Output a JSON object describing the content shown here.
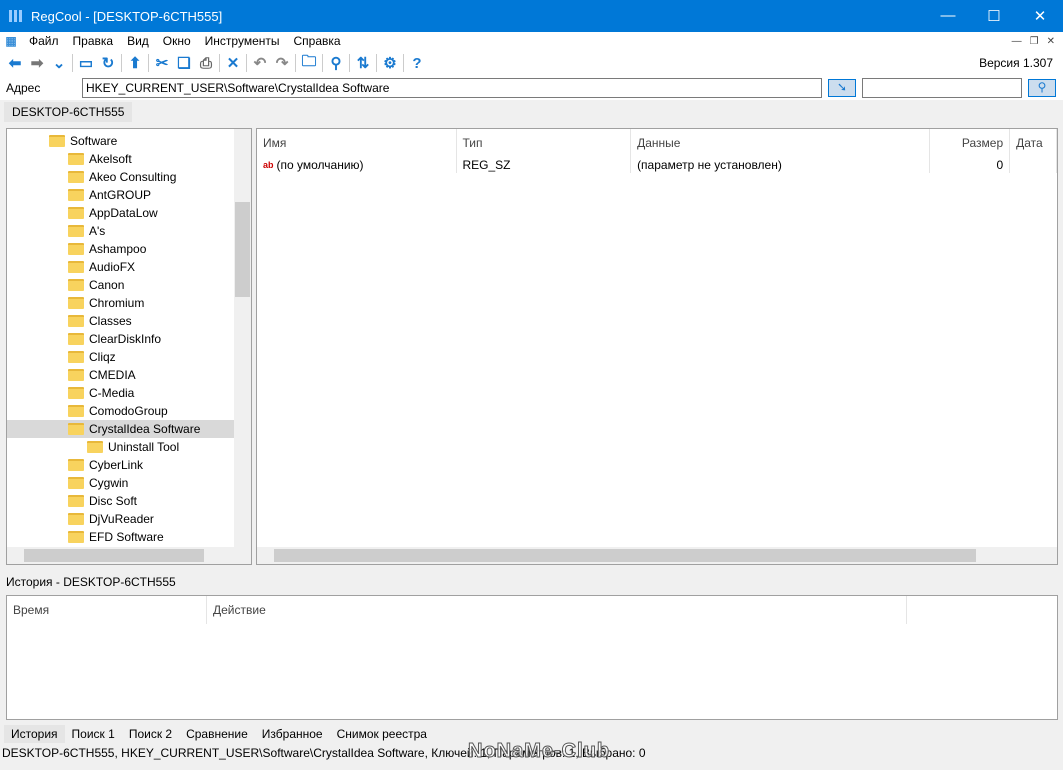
{
  "window": {
    "title": "RegCool - [DESKTOP-6CTH555]"
  },
  "menu": [
    "Файл",
    "Правка",
    "Вид",
    "Окно",
    "Инструменты",
    "Справка"
  ],
  "toolbar": {
    "icons": [
      "back-arrow-icon",
      "forward-arrow-icon",
      "dropdown-chevron-icon",
      "computer-icon",
      "refresh-icon",
      "up-arrow-icon",
      "cut-icon",
      "copy-icon",
      "import-icon",
      "delete-icon",
      "undo-icon",
      "redo-icon",
      "new-key-icon",
      "search-icon",
      "sync-icon",
      "settings-icon",
      "help-icon"
    ],
    "version": "Версия 1.307",
    "accent": "#1a7ad0"
  },
  "address": {
    "label": "Адрес",
    "value": "HKEY_CURRENT_USER\\Software\\CrystalIdea Software"
  },
  "doc_tab": "DESKTOP-6CTH555",
  "tree": {
    "root": "Software",
    "children": [
      "Akelsoft",
      "Akeo Consulting",
      "AntGROUP",
      "AppDataLow",
      "A's",
      "Ashampoo",
      "AudioFX",
      "Canon",
      "Chromium",
      "Classes",
      "ClearDiskInfo",
      "Cliqz",
      "CMEDIA",
      "C-Media",
      "ComodoGroup",
      "CrystalIdea Software"
    ],
    "selected": "CrystalIdea Software",
    "sub": "Uninstall Tool",
    "after": [
      "CyberLink",
      "Cygwin",
      "Disc Soft",
      "DjVuReader",
      "EFD Software"
    ]
  },
  "list": {
    "columns": [
      "Имя",
      "Тип",
      "Данные",
      "Размер",
      "Дата"
    ],
    "rows": [
      {
        "name": "(по умолчанию)",
        "type": "REG_SZ",
        "data": "(параметр не установлен)",
        "size": "0",
        "date": ""
      }
    ]
  },
  "history": {
    "title": "История - DESKTOP-6CTH555",
    "columns": [
      "Время",
      "Действие"
    ]
  },
  "bottom_tabs": [
    "История",
    "Поиск 1",
    "Поиск 2",
    "Сравнение",
    "Избранное",
    "Снимок реестра"
  ],
  "status": "DESKTOP-6CTH555, HKEY_CURRENT_USER\\Software\\CrystalIdea Software, Ключей: 1, Параметров: 1, Выбрано: 0",
  "watermark": "NoNaMe-Club"
}
